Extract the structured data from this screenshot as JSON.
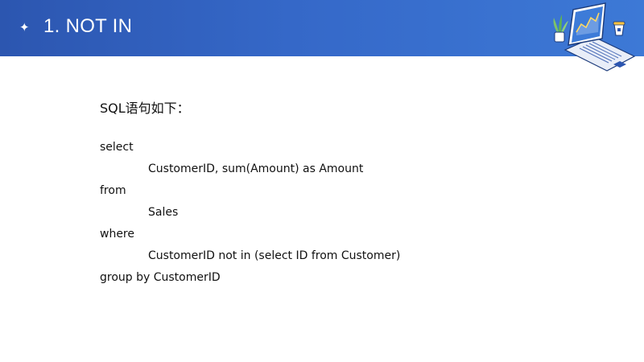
{
  "slide": {
    "title_bullet": "✦",
    "title": "1. NOT IN",
    "heading": "SQL语句如下：",
    "sql_lines": [
      {
        "text": "select",
        "indent": false
      },
      {
        "text": "CustomerID, sum(Amount) as Amount",
        "indent": true
      },
      {
        "text": "from",
        "indent": false
      },
      {
        "text": "Sales",
        "indent": true
      },
      {
        "text": "where",
        "indent": false
      },
      {
        "text": "CustomerID not in (select ID from Customer)",
        "indent": true
      },
      {
        "text": "group by CustomerID",
        "indent": false
      }
    ]
  },
  "colors": {
    "header_start": "#2c56b0",
    "header_end": "#3d79d6",
    "text": "#111111"
  },
  "icons": {
    "title_bullet": "sparkle-icon",
    "decoration": "laptop-chart-illustration"
  }
}
